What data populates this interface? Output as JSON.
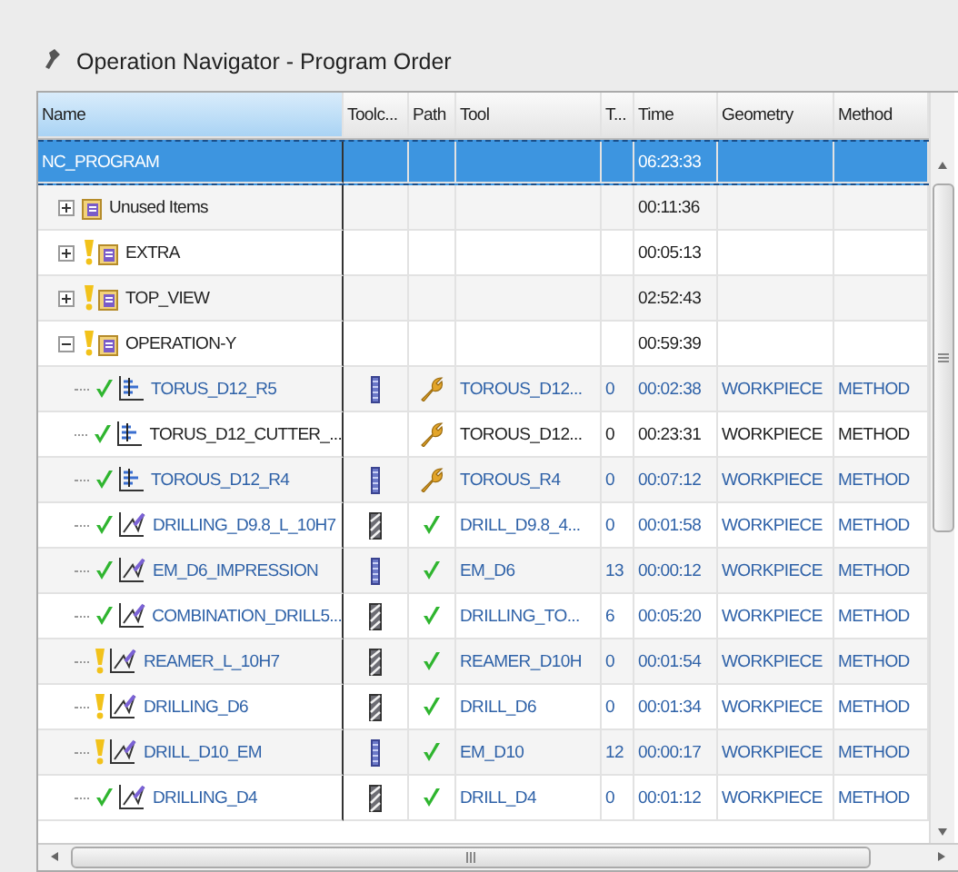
{
  "panel": {
    "title": "Operation Navigator - Program Order"
  },
  "table": {
    "columns": [
      "Name",
      "Toolc...",
      "Path",
      "Tool",
      "T...",
      "Time",
      "Geometry",
      "Method"
    ],
    "rows": [
      {
        "kind": "program",
        "name": "NC_PROGRAM",
        "selected": true,
        "time": "06:23:33",
        "children": [
          {
            "kind": "group",
            "name": "Unused Items",
            "warning": false,
            "expanded": false,
            "selected": false,
            "time": "00:11:36"
          },
          {
            "kind": "group",
            "name": "EXTRA",
            "warning": true,
            "expanded": false,
            "selected": false,
            "time": "00:05:13"
          },
          {
            "kind": "group",
            "name": "TOP_VIEW",
            "warning": true,
            "expanded": false,
            "selected": false,
            "time": "02:52:43"
          },
          {
            "kind": "group",
            "name": "OPERATION-Y",
            "warning": true,
            "expanded": true,
            "selected": false,
            "time": "00:59:39",
            "children": [
              {
                "kind": "mill",
                "name": "TORUS_D12_R5",
                "warning": false,
                "emphasized": true,
                "selected": false,
                "tool_change": true,
                "drill_tool": false,
                "path_complete": false,
                "tool": "TOROUS_D12...",
                "t": "0",
                "time": "00:02:38",
                "geometry": "WORKPIECE",
                "method": "METHOD"
              },
              {
                "kind": "mill",
                "name": "TORUS_D12_CUTTER_...",
                "warning": false,
                "emphasized": false,
                "selected": false,
                "tool_change": false,
                "path_complete": false,
                "tool": "TOROUS_D12...",
                "t": "0",
                "time": "00:23:31",
                "geometry": "WORKPIECE",
                "method": "METHOD"
              },
              {
                "kind": "mill",
                "name": "TOROUS_D12_R4",
                "warning": false,
                "emphasized": true,
                "selected": false,
                "tool_change": true,
                "drill_tool": false,
                "path_complete": false,
                "tool": "TOROUS_R4",
                "t": "0",
                "time": "00:07:12",
                "geometry": "WORKPIECE",
                "method": "METHOD"
              },
              {
                "kind": "drill",
                "name": "DRILLING_D9.8_L_10H7",
                "warning": false,
                "emphasized": true,
                "selected": false,
                "tool_change": true,
                "drill_tool": true,
                "path_complete": true,
                "tool": "DRILL_D9.8_4...",
                "t": "0",
                "time": "00:01:58",
                "geometry": "WORKPIECE",
                "method": "METHOD"
              },
              {
                "kind": "drill",
                "name": "EM_D6_IMPRESSION",
                "warning": false,
                "emphasized": true,
                "selected": false,
                "tool_change": true,
                "drill_tool": false,
                "path_complete": true,
                "tool": "EM_D6",
                "t": "13",
                "time": "00:00:12",
                "geometry": "WORKPIECE",
                "method": "METHOD"
              },
              {
                "kind": "drill",
                "name": "COMBINATION_DRILL5...",
                "warning": false,
                "emphasized": true,
                "selected": false,
                "tool_change": true,
                "drill_tool": true,
                "path_complete": true,
                "tool": "DRILLING_TO...",
                "t": "6",
                "time": "00:05:20",
                "geometry": "WORKPIECE",
                "method": "METHOD"
              },
              {
                "kind": "drill",
                "name": "REAMER_L_10H7",
                "warning": true,
                "emphasized": true,
                "selected": false,
                "tool_change": true,
                "drill_tool": true,
                "path_complete": true,
                "tool": "REAMER_D10H",
                "t": "0",
                "time": "00:01:54",
                "geometry": "WORKPIECE",
                "method": "METHOD"
              },
              {
                "kind": "drill",
                "name": "DRILLING_D6",
                "warning": true,
                "emphasized": true,
                "selected": false,
                "tool_change": true,
                "drill_tool": true,
                "path_complete": true,
                "tool": "DRILL_D6",
                "t": "0",
                "time": "00:01:34",
                "geometry": "WORKPIECE",
                "method": "METHOD"
              },
              {
                "kind": "drill",
                "name": "DRILL_D10_EM",
                "warning": true,
                "emphasized": true,
                "selected": false,
                "tool_change": true,
                "drill_tool": false,
                "path_complete": true,
                "tool": "EM_D10",
                "t": "12",
                "time": "00:00:17",
                "geometry": "WORKPIECE",
                "method": "METHOD"
              },
              {
                "kind": "drill",
                "name": "DRILLING_D4",
                "warning": false,
                "emphasized": true,
                "selected": false,
                "tool_change": true,
                "drill_tool": true,
                "path_complete": true,
                "tool": "DRILL_D4",
                "t": "0",
                "time": "00:01:12",
                "geometry": "WORKPIECE",
                "method": "METHOD"
              }
            ]
          }
        ]
      }
    ]
  }
}
